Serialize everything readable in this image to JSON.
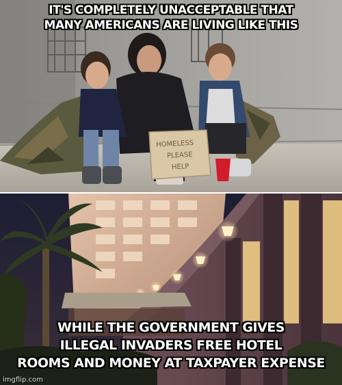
{
  "meme": {
    "top_caption": [
      "IT'S COMPLETELY UNACCEPTABLE THAT",
      "MANY AMERICANS ARE LIVING LIKE THIS"
    ],
    "bottom_caption": [
      "WHILE THE GOVERNMENT GIVES",
      "ILLEGAL INVADERS FREE HOTEL",
      "ROOMS AND MONEY AT TAXPAYER EXPENSE"
    ],
    "sign_text": [
      "HOMELESS",
      "PLEASE",
      "HELP"
    ],
    "watermark": "imgflip.com"
  },
  "colors": {
    "caption_text": "#ffffff",
    "caption_outline": "#000000",
    "sidewalk": "#b9b3aa",
    "wall": "#9a9894",
    "hotel_facade": "#d7b49a",
    "night_sky": "#1a1b2e",
    "palm": "#2f3a22"
  }
}
